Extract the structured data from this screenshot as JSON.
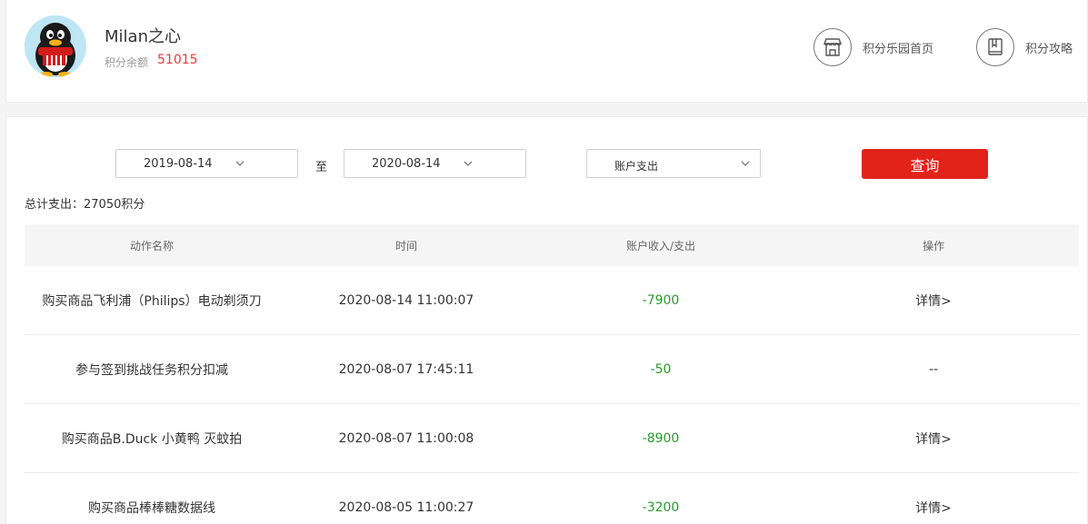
{
  "profile": {
    "username": "Milan之心",
    "balance_label": "积分余额",
    "balance_value": "51015"
  },
  "top_links": {
    "home_label": "积分乐园首页",
    "guide_label": "积分攻略"
  },
  "filters": {
    "start_date": "2019-08-14",
    "to_label": "至",
    "end_date": "2020-08-14",
    "type_selected": "账户支出",
    "query_label": "查询"
  },
  "summary": {
    "total_text": "总计支出：27050积分"
  },
  "table": {
    "headers": [
      "动作名称",
      "时间",
      "账户收入/支出",
      "操作"
    ],
    "rows": [
      {
        "action": "购买商品飞利浦（Philips）电动剃须刀",
        "time": "2020-08-14 11:00:07",
        "amount": "-7900",
        "op": "详情>"
      },
      {
        "action": "参与签到挑战任务积分扣减",
        "time": "2020-08-07 17:45:11",
        "amount": "-50",
        "op": "--"
      },
      {
        "action": "购买商品B.Duck 小黄鸭 灭蚊拍",
        "time": "2020-08-07 11:00:08",
        "amount": "-8900",
        "op": "详情>"
      },
      {
        "action": "购买商品棒棒糖数据线",
        "time": "2020-08-05 11:00:27",
        "amount": "-3200",
        "op": "详情>"
      }
    ]
  },
  "colors": {
    "accent_red": "#e2231a",
    "amount_green": "#2a9a2a",
    "balance_red": "#e4393c"
  }
}
